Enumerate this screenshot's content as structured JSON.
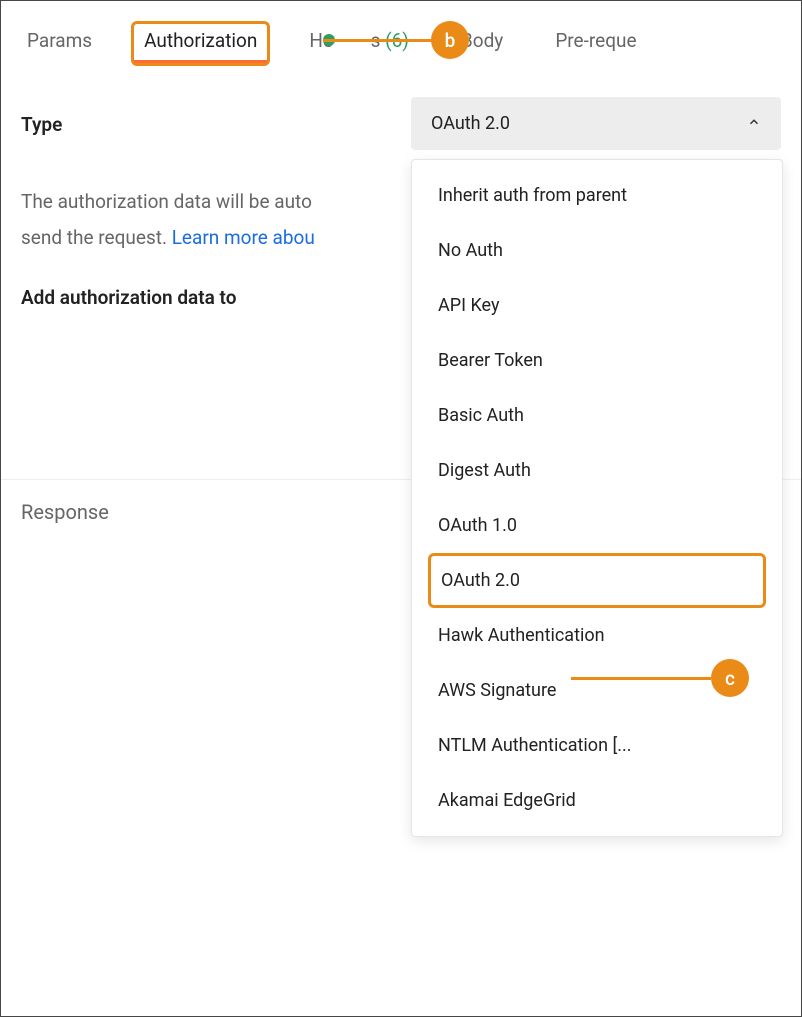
{
  "tabs": {
    "params": "Params",
    "authorization": "Authorization",
    "headers_prefix": "He",
    "headers_suffix": "s",
    "headers_count": "(6)",
    "body": "Body",
    "prereq": "Pre-reque"
  },
  "type_label": "Type",
  "select": {
    "selected": "OAuth 2.0"
  },
  "dropdown": {
    "inherit": "Inherit auth from parent",
    "noauth": "No Auth",
    "apikey": "API Key",
    "bearer": "Bearer Token",
    "basic": "Basic Auth",
    "digest": "Digest Auth",
    "oauth1": "OAuth 1.0",
    "oauth2": "OAuth 2.0",
    "hawk": "Hawk Authentication",
    "aws": "AWS Signature",
    "ntlm": "NTLM Authentication [...",
    "akamai": "Akamai EdgeGrid"
  },
  "desc_text": "The authorization data will be auto",
  "desc_text2": "send the request. ",
  "desc_link": "Learn more abou",
  "add_label": "Add authorization data to",
  "response_label": "Response",
  "callouts": {
    "b": "b",
    "c": "c"
  }
}
